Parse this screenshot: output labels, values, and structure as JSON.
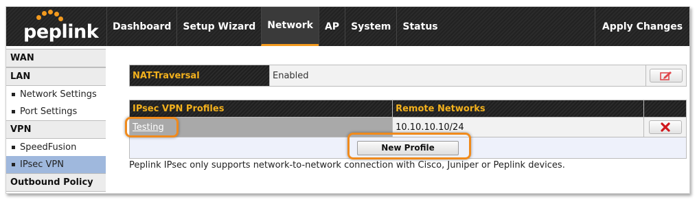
{
  "brand": {
    "logo_text": "peplink",
    "accent": "#f39a1e"
  },
  "nav": {
    "items": [
      {
        "label": "Dashboard"
      },
      {
        "label": "Setup Wizard"
      },
      {
        "label": "Network"
      },
      {
        "label": "AP"
      },
      {
        "label": "System"
      },
      {
        "label": "Status"
      }
    ],
    "active": "Network",
    "apply_label": "Apply Changes"
  },
  "sidebar": {
    "wan": "WAN",
    "lan": "LAN",
    "lan_items": [
      "Network Settings",
      "Port Settings"
    ],
    "vpn": "VPN",
    "vpn_items": [
      "SpeedFusion",
      "IPsec VPN"
    ],
    "active_item": "IPsec VPN",
    "outbound": "Outbound Policy"
  },
  "nat": {
    "label": "NAT-Traversal",
    "value": "Enabled",
    "edit_icon": "edit-icon"
  },
  "ipsec": {
    "col_profiles": "IPsec VPN Profiles",
    "col_networks": "Remote Networks",
    "rows": [
      {
        "profile": "Testing",
        "network": "10.10.10.10/24",
        "delete_icon": "delete-icon"
      }
    ],
    "new_profile_label": "New Profile",
    "note": "Peplink IPsec only supports network-to-network connection with Cisco, Juniper or Peplink devices."
  }
}
